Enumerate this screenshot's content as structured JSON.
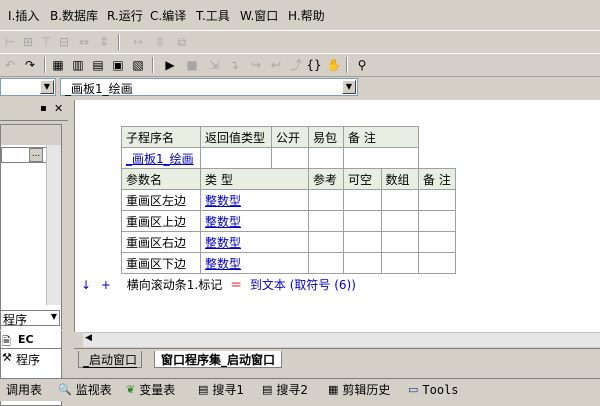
{
  "menu": [
    "I.插入",
    "B.数据库",
    "R.运行",
    "C.编译",
    "T.工具",
    "W.窗口",
    "H.帮助"
  ],
  "combo": {
    "left_value": "",
    "right_value": "_画板1_绘画"
  },
  "left_panel": {
    "item_program": "程序",
    "tab_ec": "EC",
    "tab_program": "程序",
    "lp_value": "..."
  },
  "sub_table": {
    "headers": [
      "子程序名",
      "返回值类型",
      "公开",
      "易包",
      "备 注"
    ],
    "name": "_画板1_绘画",
    "param_headers": [
      "参数名",
      "类 型",
      "参考",
      "可空",
      "数组",
      "备 注"
    ],
    "params": [
      {
        "name": "重画区左边",
        "type": "整数型"
      },
      {
        "name": "重画区上边",
        "type": "整数型"
      },
      {
        "name": "重画区右边",
        "type": "整数型"
      },
      {
        "name": "重画区下边",
        "type": "整数型"
      }
    ]
  },
  "code_line": {
    "prefix": "横向滚动条1.标记",
    "op": "＝",
    "expr": "到文本 (取符号 (6))"
  },
  "doc_tabs": [
    "_启动窗口",
    "窗口程序集_启动窗口"
  ],
  "bottom_tabs": [
    "调用表",
    "监视表",
    "变量表",
    "搜寻1",
    "搜寻2",
    "剪辑历史",
    "Tools"
  ],
  "colors": {
    "accent_blue": "#0000cc",
    "header_bg": "#e8eee2",
    "chrome": "#d4d0c8",
    "code_red": "#cc0000"
  }
}
